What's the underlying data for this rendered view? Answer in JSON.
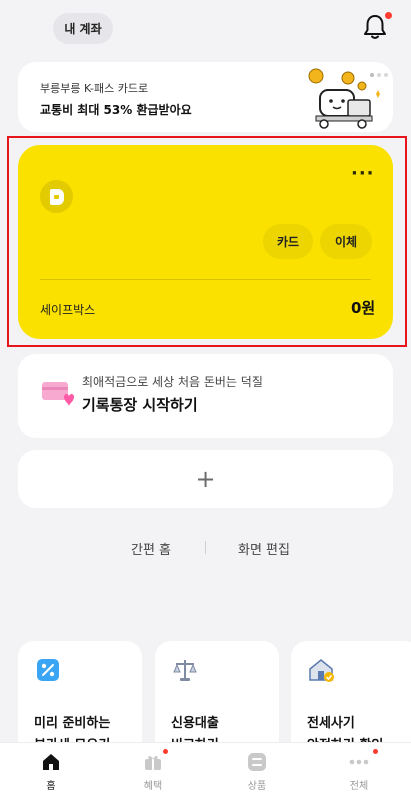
{
  "header": {
    "account_tab": "내 계좌"
  },
  "promo": {
    "subtitle": "부릉부릉 K-패스 카드로",
    "title": "교통비 최대 53% 환급받아요"
  },
  "account_card": {
    "more_label": "···",
    "card_button": "카드",
    "transfer_button": "이체",
    "safebox_label": "세이프박스",
    "safebox_amount": "0원"
  },
  "savings": {
    "subtitle": "최애적금으로 세상 처음 돈버는 덕질",
    "title": "기록통장 시작하기"
  },
  "add_card": {
    "label": "+"
  },
  "home_links": {
    "simple_home": "간편 홈",
    "edit_screen": "화면 편집"
  },
  "tiles": [
    {
      "text": "미리 준비하는\n부가세 모으기",
      "icon": "percent-icon"
    },
    {
      "text": "신용대출\n비교하기",
      "icon": "scale-icon"
    },
    {
      "text": "전세사기\n안전하기 확인",
      "icon": "house-check-icon"
    }
  ],
  "nav": {
    "home": "홈",
    "benefit": "혜택",
    "products": "상품",
    "all": "전체"
  },
  "colors": {
    "accent_yellow": "#fae100",
    "notification_red": "#ff3b2f",
    "highlight_red": "#e8141c"
  }
}
